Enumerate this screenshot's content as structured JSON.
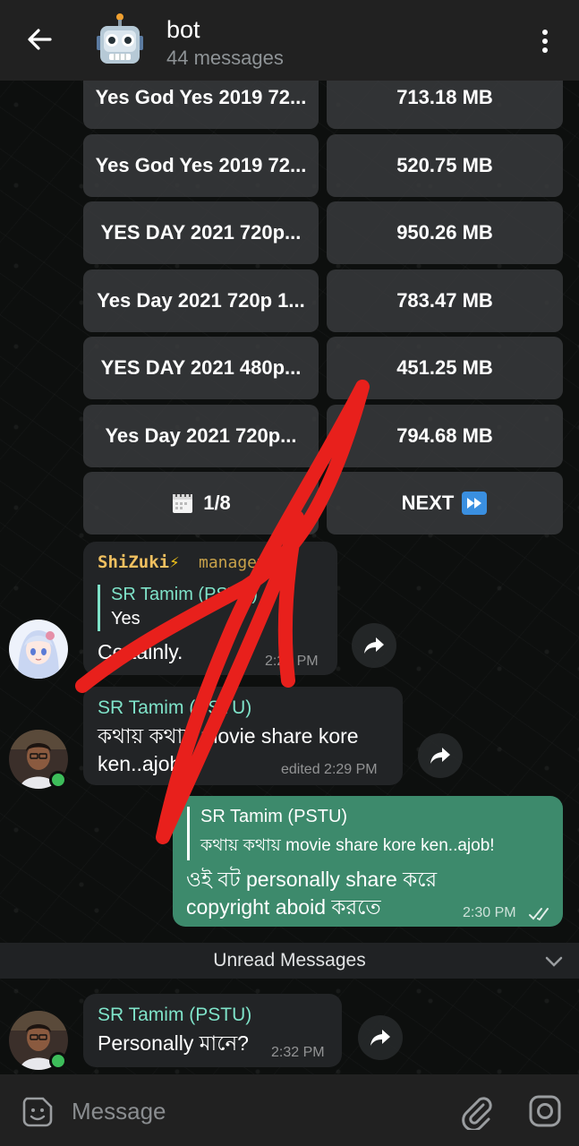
{
  "header": {
    "title": "bot",
    "subtitle": "44 messages"
  },
  "keyboard": {
    "rows": [
      {
        "left": "Yes God Yes 2019 72...",
        "right": "713.18 MB"
      },
      {
        "left": "Yes God Yes 2019 72...",
        "right": "520.75 MB"
      },
      {
        "left": "YES DAY 2021 720p...",
        "right": "950.26 MB"
      },
      {
        "left": "Yes Day 2021 720p 1...",
        "right": "783.47 MB"
      },
      {
        "left": "YES DAY 2021 480p...",
        "right": "451.25 MB"
      },
      {
        "left": "Yes Day 2021 720p...",
        "right": "794.68 MB"
      }
    ],
    "page_label": "1/8",
    "next_label": "NEXT"
  },
  "messages": {
    "shizuki": {
      "sender": "ShiZuki",
      "role": "managemen",
      "reply_name": "SR Tamim (PSTU)",
      "reply_text": "Yes",
      "text": "Certainly.",
      "time": "2:28 PM"
    },
    "tamim1": {
      "sender": "SR Tamim (PSTU)",
      "line1": "কথায় কথায় movie share kore",
      "line2": "ken..ajob!",
      "time": "edited 2:29 PM"
    },
    "outgoing": {
      "reply_name": "SR Tamim (PSTU)",
      "reply_text": "কথায় কথায় movie share kore ken..ajob!",
      "line1": "ওই বট personally share করে",
      "line2": "copyright aboid করতে",
      "time": "2:30 PM"
    },
    "unread_label": "Unread Messages",
    "tamim2": {
      "sender": "SR Tamim (PSTU)",
      "text": "Personally মানে?",
      "time": "2:32 PM"
    }
  },
  "input": {
    "placeholder": "Message"
  },
  "colors": {
    "accent_name": "#7fe3c9",
    "outgoing_bubble": "#3d8a6c",
    "shizuki_name": "#f0c060",
    "annotation": "#e8201c"
  }
}
